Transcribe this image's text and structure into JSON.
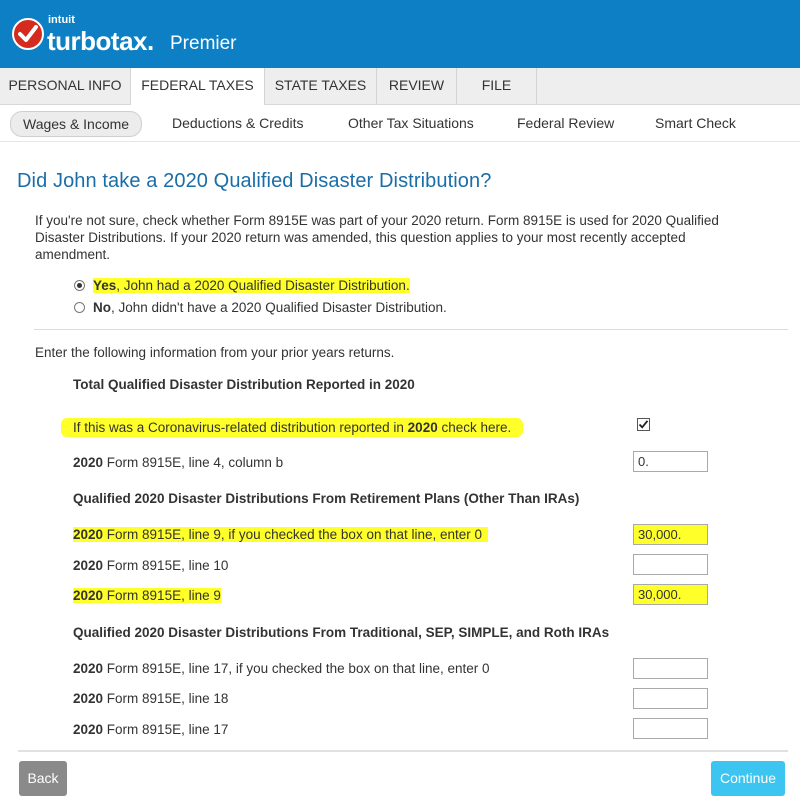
{
  "header": {
    "company": "intuit",
    "brand": "turbotax.",
    "edition": "Premier",
    "colors": {
      "bar": "#0d7fc4",
      "logo": "#d52b1e"
    }
  },
  "tabs": [
    {
      "label": "PERSONAL INFO"
    },
    {
      "label": "FEDERAL TAXES"
    },
    {
      "label": "STATE TAXES"
    },
    {
      "label": "REVIEW"
    },
    {
      "label": "FILE"
    }
  ],
  "subnav": [
    {
      "label": "Wages & Income"
    },
    {
      "label": "Deductions & Credits"
    },
    {
      "label": "Other Tax Situations"
    },
    {
      "label": "Federal Review"
    },
    {
      "label": "Smart Check"
    }
  ],
  "page": {
    "title": "Did John take a 2020 Qualified Disaster Distribution?",
    "intro": "If you're not sure, check whether Form 8915E was part of your 2020 return. Form 8915E is used for 2020 Qualified Disaster Distributions. If your 2020 return was amended, this question applies to your most recently accepted amendment.",
    "options": [
      {
        "bold": "Yes",
        "rest": ", John had a 2020 Qualified Disaster Distribution.",
        "selected": true
      },
      {
        "bold": "No",
        "rest": ", John didn't have a 2020 Qualified Disaster Distribution.",
        "selected": false
      }
    ],
    "instruction": "Enter the following information from your prior years returns."
  },
  "sections": {
    "s1": "Total Qualified Disaster Distribution Reported in 2020",
    "s2": "Qualified 2020 Disaster Distributions From Retirement Plans (Other Than IRAs)",
    "s3": "Qualified 2020 Disaster Distributions From Traditional, SEP, SIMPLE, and Roth IRAs"
  },
  "coronavirus": {
    "pre": "If this was a Coronavirus-related distribution reported in ",
    "bold": "2020",
    "post": " check here.",
    "checked": true
  },
  "rows": [
    {
      "bold": "2020",
      "label": " Form 8915E, line 4, column b",
      "value": "0."
    },
    {
      "bold": "2020",
      "label": " Form 8915E, line 9, if you checked the box on that line, enter 0",
      "value": "30,000."
    },
    {
      "bold": "2020",
      "label": " Form 8915E, line 10",
      "value": ""
    },
    {
      "bold": "2020",
      "label": " Form 8915E, line 9",
      "value": "30,000."
    },
    {
      "bold": "2020",
      "label": " Form 8915E, line 17, if you checked the box on that line, enter 0",
      "value": ""
    },
    {
      "bold": "2020",
      "label": " Form 8915E, line 18",
      "value": ""
    },
    {
      "bold": "2020",
      "label": " Form 8915E, line 17",
      "value": ""
    }
  ],
  "buttons": {
    "back": "Back",
    "continue": "Continue"
  },
  "colors": {
    "highlight": "#ffff2a",
    "title": "#1a6ea8",
    "continue": "#3cc5f0",
    "back": "#8a8a8a"
  }
}
